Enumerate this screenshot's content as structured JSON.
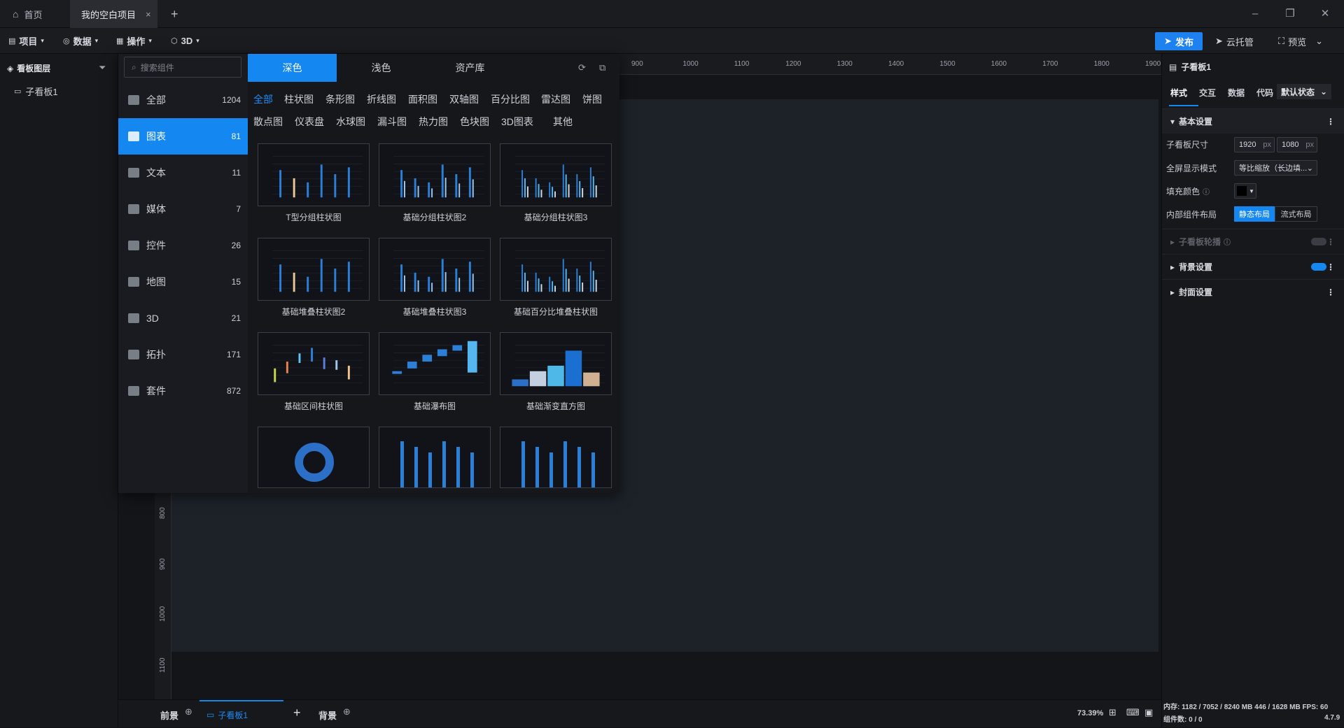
{
  "tabs": {
    "home": "首页",
    "project": "我的空白项目",
    "new": "+"
  },
  "menu": {
    "project": "项目",
    "data": "数据",
    "ops": "操作",
    "three_d": "3D"
  },
  "actions": {
    "publish": "发布",
    "cloud": "云托管",
    "preview": "预览"
  },
  "layers": {
    "title": "看板图层",
    "item": "子看板1"
  },
  "ruler": {
    "top": [
      "900",
      "1000",
      "1100",
      "1200",
      "1300",
      "1400",
      "1500",
      "1600",
      "1700",
      "1800",
      "1900"
    ],
    "left": [
      "800",
      "900",
      "1000",
      "1100"
    ]
  },
  "library": {
    "search_placeholder": "搜索组件",
    "tabs": [
      "深色",
      "浅色",
      "资产库"
    ],
    "categories": [
      {
        "label": "全部",
        "count": "1204",
        "icon": "grid-icon"
      },
      {
        "label": "图表",
        "count": "81",
        "icon": "bar-chart-icon"
      },
      {
        "label": "文本",
        "count": "11",
        "icon": "text-icon"
      },
      {
        "label": "媒体",
        "count": "7",
        "icon": "media-icon"
      },
      {
        "label": "控件",
        "count": "26",
        "icon": "control-icon"
      },
      {
        "label": "地图",
        "count": "15",
        "icon": "map-icon"
      },
      {
        "label": "3D",
        "count": "21",
        "icon": "cube-icon"
      },
      {
        "label": "拓扑",
        "count": "171",
        "icon": "topology-icon"
      },
      {
        "label": "套件",
        "count": "872",
        "icon": "kit-icon"
      }
    ],
    "filters_row1": [
      "全部",
      "柱状图",
      "条形图",
      "折线图",
      "面积图",
      "双轴图",
      "百分比图",
      "雷达图",
      "饼图"
    ],
    "filters_row2": [
      "散点图",
      "仪表盘",
      "水球图",
      "漏斗图",
      "热力图",
      "色块图",
      "3D图表",
      "其他"
    ],
    "cards": [
      "T型分组柱状图",
      "基础分组柱状图2",
      "基础分组柱状图3",
      "基础堆叠柱状图2",
      "基础堆叠柱状图3",
      "基础百分比堆叠柱状图",
      "基础区间柱状图",
      "基础瀑布图",
      "基础渐变直方图"
    ]
  },
  "bottom": {
    "front": "前景",
    "board": "子看板1",
    "add": "+",
    "back": "背景",
    "zoom": "73.39%"
  },
  "right": {
    "title": "子看板1",
    "tabs": [
      "样式",
      "交互",
      "数据",
      "代码"
    ],
    "state": "默认状态",
    "basic": "基本设置",
    "size_label": "子看板尺寸",
    "width": "1920",
    "height": "1080",
    "unit": "px",
    "fullscreen_label": "全屏显示模式",
    "fullscreen_value": "等比缩放（长边填...",
    "fill_label": "填充颜色",
    "layout_label": "内部组件布局",
    "layout_static": "静态布局",
    "layout_flow": "流式布局",
    "carousel": "子看板轮播",
    "bg": "背景设置",
    "cover": "封面设置",
    "status1": "内存:  1182 / 7052 / 8240 MB  446 / 1628 MB   FPS:  60",
    "status2": "组件数: 0 / 0",
    "version": "4.7.9"
  },
  "colors": {
    "accent": "#1487f0",
    "board": "#1d2229"
  }
}
